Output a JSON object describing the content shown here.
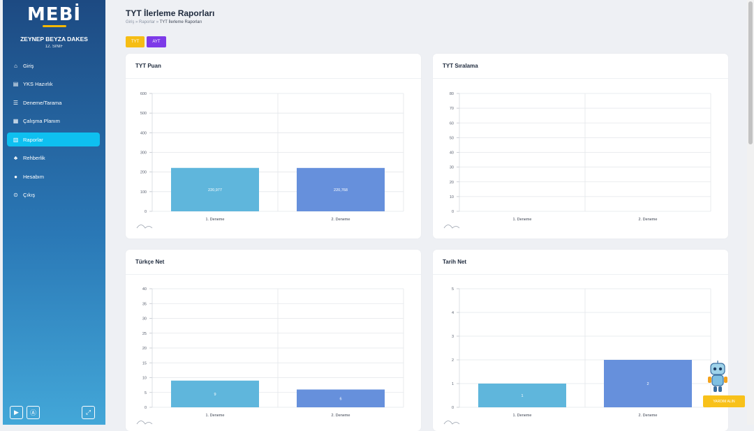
{
  "app": {
    "logo": "MEBİ"
  },
  "user": {
    "name": "ZEYNEP BEYZA DAKES",
    "class": "12. SINIF"
  },
  "nav": [
    {
      "label": "Giriş",
      "icon": "home-icon",
      "glyph": "⌂",
      "active": false
    },
    {
      "label": "YKS Hazırlık",
      "icon": "book-icon",
      "glyph": "▤",
      "active": false
    },
    {
      "label": "Deneme/Tarama",
      "icon": "layers-icon",
      "glyph": "☰",
      "active": false
    },
    {
      "label": "Çalışma Planım",
      "icon": "calendar-icon",
      "glyph": "▦",
      "active": false
    },
    {
      "label": "Raporlar",
      "icon": "chart-icon",
      "glyph": "▥",
      "active": true
    },
    {
      "label": "Rehberlik",
      "icon": "users-icon",
      "glyph": "♣",
      "active": false
    },
    {
      "label": "Hesabım",
      "icon": "user-icon",
      "glyph": "●",
      "active": false
    },
    {
      "label": "Çıkış",
      "icon": "logout-icon",
      "glyph": "⊙",
      "active": false
    }
  ],
  "header": {
    "title": "TYT İlerleme Raporları",
    "breadcrumb": {
      "home": "Giriş",
      "sep": "»",
      "reports": "Raporlar",
      "current": "TYT İlerleme Raporları"
    }
  },
  "tabs": {
    "tyt": "TYT",
    "ayt": "AYT"
  },
  "helper": {
    "label": "YARDIM ALIN"
  },
  "colors": {
    "bar1": "#5fb6dc",
    "bar2": "#6690dc",
    "accent": "#0ec0f0"
  },
  "charts": [
    {
      "title": "TYT Puan",
      "chart_data": {
        "type": "bar",
        "categories": [
          "1. Deneme",
          "2. Deneme"
        ],
        "values": [
          220.977,
          220.768
        ],
        "value_labels": [
          "220,977",
          "220,768"
        ],
        "yticks": [
          0,
          100,
          200,
          300,
          400,
          500,
          600
        ],
        "ylim": [
          0,
          600
        ]
      }
    },
    {
      "title": "TYT Sıralama",
      "chart_data": {
        "type": "bar",
        "categories": [
          "1. Deneme",
          "2. Deneme"
        ],
        "values": [],
        "value_labels": [],
        "yticks": [
          0,
          10,
          20,
          30,
          40,
          50,
          60,
          70,
          80
        ],
        "ylim": [
          0,
          80
        ]
      }
    },
    {
      "title": "Türkçe Net",
      "chart_data": {
        "type": "bar",
        "categories": [
          "1. Deneme",
          "2. Deneme"
        ],
        "values": [
          9,
          6
        ],
        "value_labels": [
          "9",
          "6"
        ],
        "yticks": [
          0,
          5,
          10,
          15,
          20,
          25,
          30,
          35,
          40
        ],
        "ylim": [
          0,
          40
        ]
      }
    },
    {
      "title": "Tarih Net",
      "chart_data": {
        "type": "bar",
        "categories": [
          "1. Deneme",
          "2. Deneme"
        ],
        "values": [
          1,
          2
        ],
        "value_labels": [
          "1",
          "2"
        ],
        "yticks": [
          0,
          1,
          2,
          3,
          4,
          5
        ],
        "ylim": [
          0,
          5
        ]
      }
    }
  ]
}
